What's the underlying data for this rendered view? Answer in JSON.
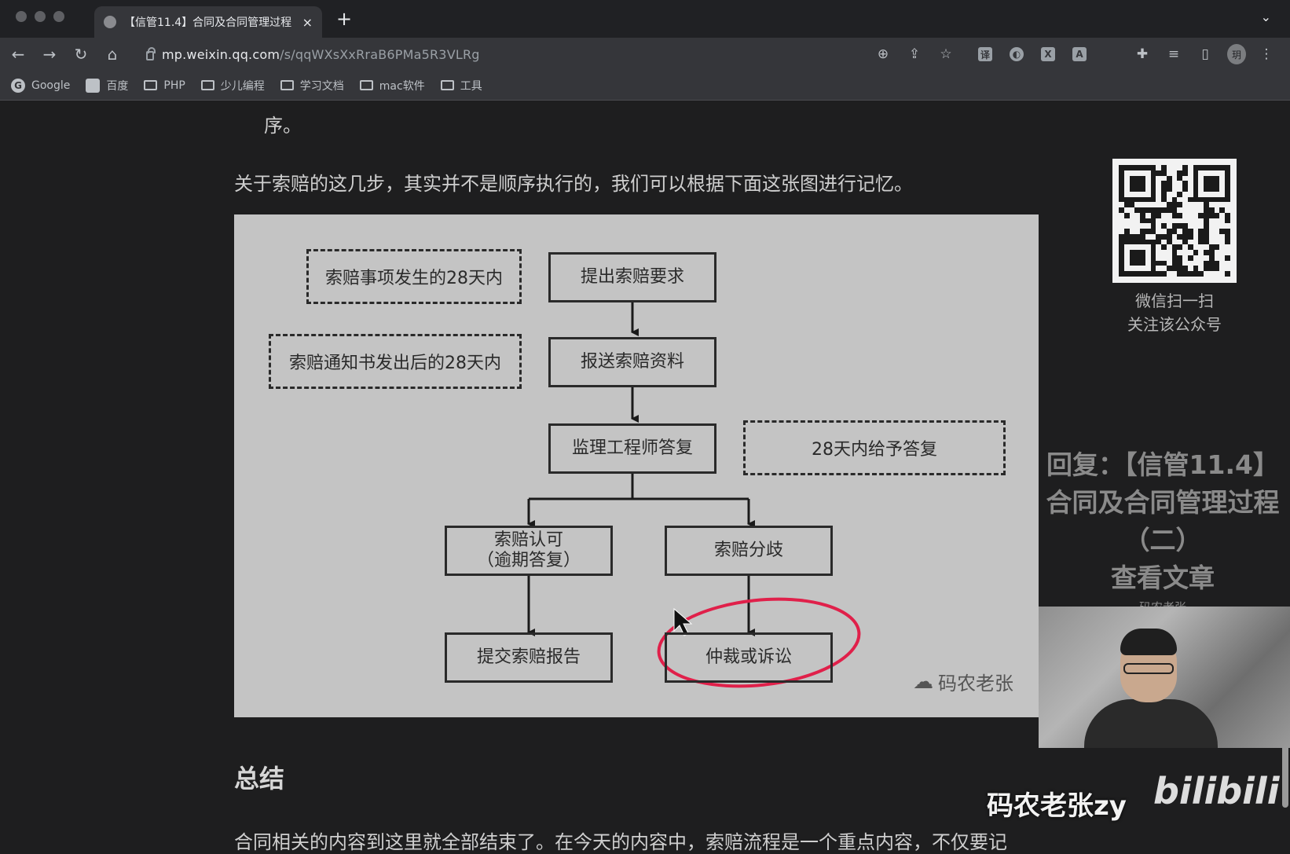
{
  "browser": {
    "tab_title": "【信管11.4】合同及合同管理过程",
    "url_host": "mp.weixin.qq.com",
    "url_path": "/s/qqWXsXxRraB6PMa5R3VLRg",
    "new_tab_label": "+",
    "tab_close_label": "×",
    "bookmarks": [
      {
        "label": "Google",
        "icon": "google-icon"
      },
      {
        "label": "百度",
        "icon": "baidu-icon"
      },
      {
        "label": "PHP",
        "icon": "folder-icon"
      },
      {
        "label": "少儿编程",
        "icon": "folder-icon"
      },
      {
        "label": "学习文档",
        "icon": "folder-icon"
      },
      {
        "label": "mac软件",
        "icon": "folder-icon"
      },
      {
        "label": "工具",
        "icon": "folder-icon"
      }
    ],
    "avatar_text": "玥"
  },
  "article": {
    "top_fragment": "序。",
    "intro": "关于索赔的这几步，其实并不是顺序执行的，我们可以根据下面这张图进行记忆。",
    "section_title": "总结",
    "conclusion": "合同相关的内容到这里就全部结束了。在今天的内容中，索赔流程是一个重点内容，不仅要记"
  },
  "flowchart": {
    "notes": {
      "n1": "索赔事项发生的28天内",
      "n2": "索赔通知书发出后的28天内",
      "n3": "28天内给予答复"
    },
    "steps": {
      "s1": "提出索赔要求",
      "s2": "报送索赔资料",
      "s3": "监理工程师答复",
      "s4a": "索赔认可",
      "s4b": "（逾期答复）",
      "s5": "索赔分歧",
      "s6": "提交索赔报告",
      "s7": "仲裁或诉讼"
    },
    "watermark": "码农老张"
  },
  "sidebar": {
    "qr_caption_1": "微信扫一扫",
    "qr_caption_2": "关注该公众号",
    "promo_line1": "回复：【信管11.4】",
    "promo_line2": "合同及合同管理过程",
    "promo_line3": "（二）",
    "promo_link": "查看文章",
    "promo_author": "码农老张"
  },
  "overlay": {
    "streamer": "码农老张zy",
    "platform": "bilibili"
  },
  "colors": {
    "annotation_circle": "#e0204a",
    "figure_bg": "#c4c4c4"
  }
}
